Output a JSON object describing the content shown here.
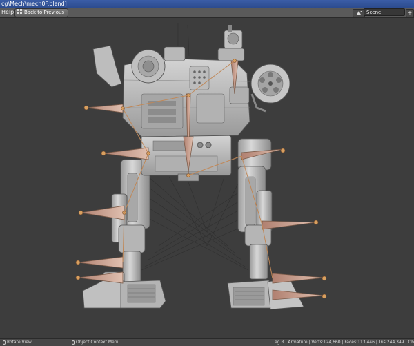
{
  "window": {
    "title": "cg\\Mech\\mech0F.blend]"
  },
  "menubar": {
    "help_label": "Help",
    "back_label": "Back to Previous",
    "scene_label": "Scene",
    "scene_add": "+"
  },
  "icons": {
    "back": "grid-icon",
    "scene": "scene-icon",
    "mouse": "mouse-icon"
  },
  "statusbar": {
    "hint_left": "Rotate View",
    "hint_middle": "Object Context Menu",
    "stats": "Leg.R | Armature | Verts:124,660 | Faces:113,446 | Tris:244,349 | Ob"
  },
  "colors": {
    "viewport_bg": "#3d3d3d",
    "bone": "#c09070",
    "bone_dark": "#8a7060",
    "joint": "#d8a060",
    "mesh_light": "#c8c8c8",
    "mesh_dark": "#8a8a8a"
  }
}
